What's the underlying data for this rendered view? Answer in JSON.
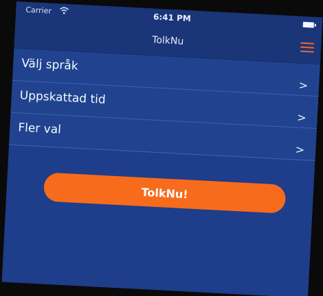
{
  "status_bar": {
    "carrier": "Carrier",
    "time": "6:41 PM",
    "wifi_icon": "wifi-icon",
    "battery_icon": "battery-icon"
  },
  "nav": {
    "title": "TolkNu",
    "menu_icon": "hamburger-menu-icon",
    "menu_color": "#f3662a"
  },
  "rows": [
    {
      "label": "Välj språk",
      "chevron": ">"
    },
    {
      "label": "Uppskattad tid",
      "chevron": ">"
    },
    {
      "label": "Fler val",
      "chevron": ">"
    }
  ],
  "action": {
    "label": "TolkNu!",
    "color": "#f76b1c"
  },
  "colors": {
    "background": "#1e3d8a",
    "row_background": "#21438f",
    "accent": "#f76b1c"
  }
}
